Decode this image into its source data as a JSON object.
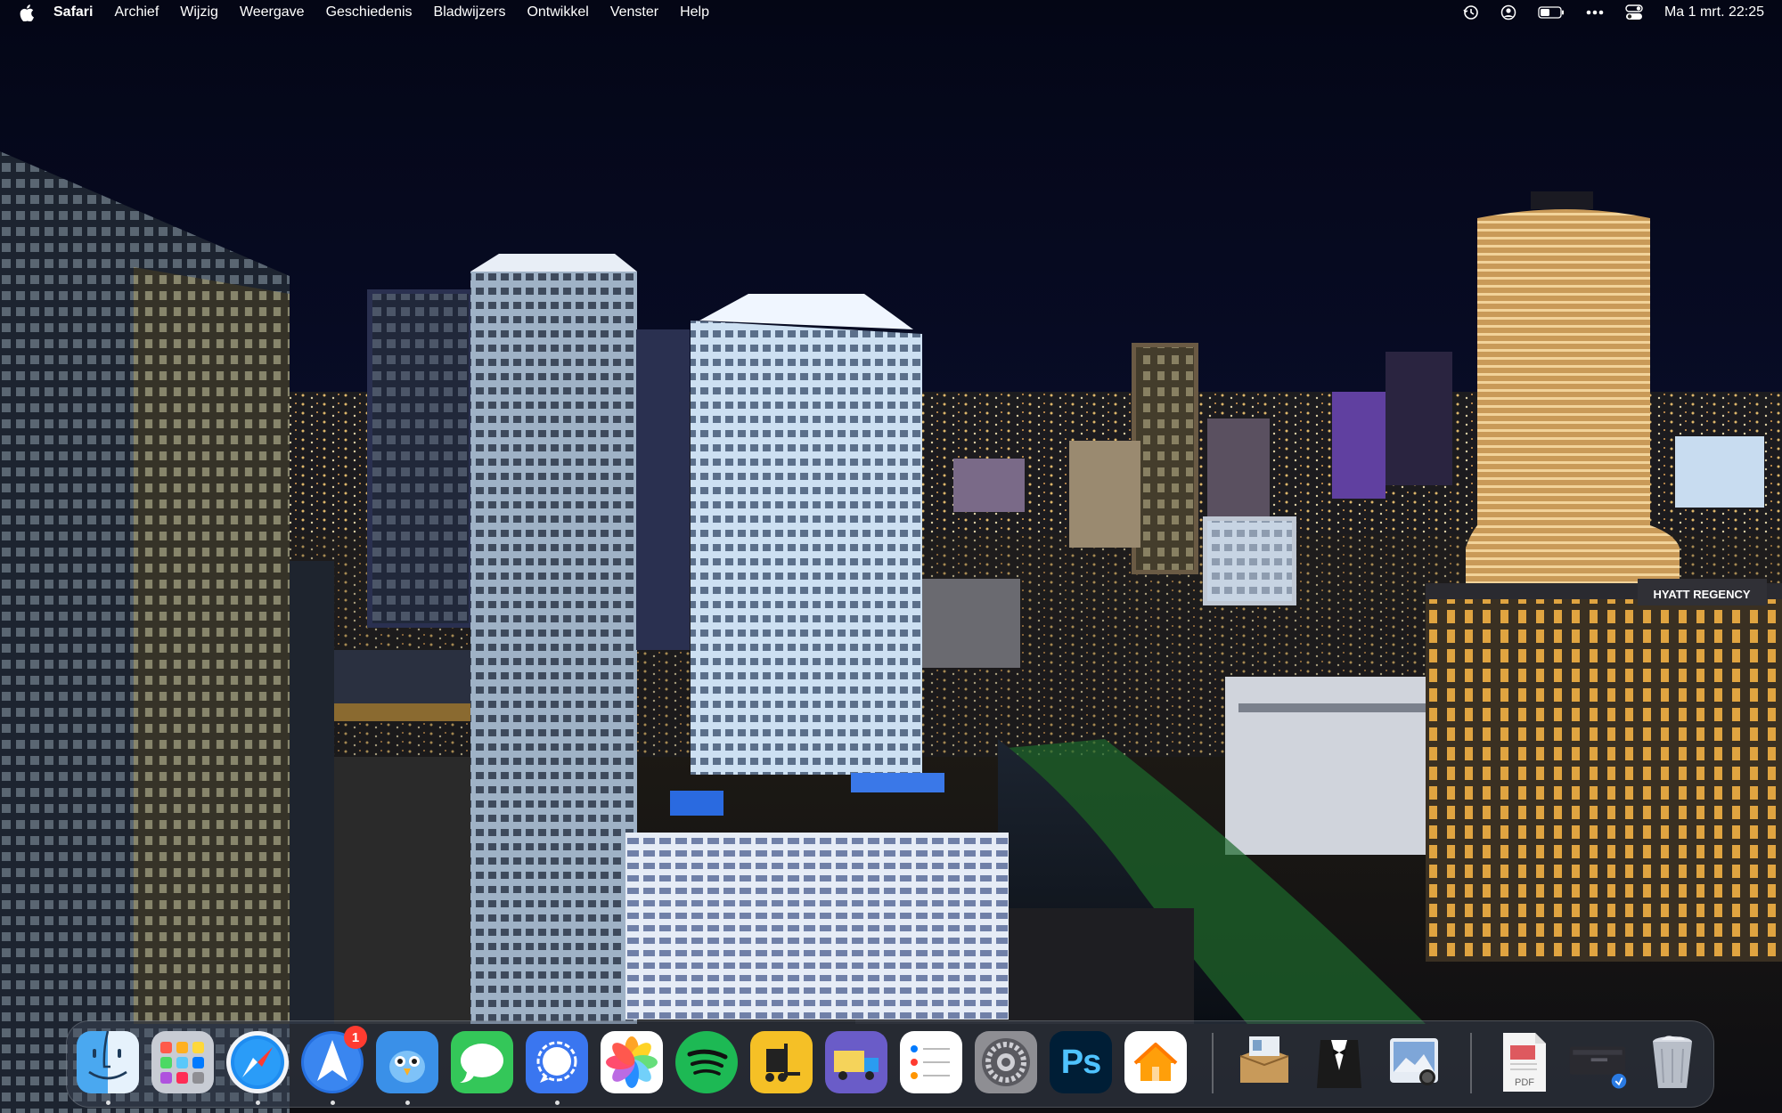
{
  "menubar": {
    "app_name": "Safari",
    "menus": [
      "Archief",
      "Wijzig",
      "Weergave",
      "Geschiedenis",
      "Bladwijzers",
      "Ontwikkel",
      "Venster",
      "Help"
    ],
    "status_icons": [
      "time-machine-icon",
      "user-icon",
      "battery-icon",
      "more-dots-icon",
      "control-center-icon"
    ],
    "clock": "Ma 1 mrt.  22:25"
  },
  "wallpaper": {
    "building_sign": "HYATT REGENCY"
  },
  "dock": {
    "apps": [
      {
        "name": "Finder",
        "icon": "finder-icon"
      },
      {
        "name": "Launchpad",
        "icon": "launchpad-icon"
      },
      {
        "name": "Safari",
        "icon": "safari-icon"
      },
      {
        "name": "Spark",
        "icon": "spark-mail-icon",
        "badge": "1"
      },
      {
        "name": "Tweetbot",
        "icon": "tweetbot-icon"
      },
      {
        "name": "Berichten",
        "icon": "messages-icon"
      },
      {
        "name": "Signal",
        "icon": "signal-icon"
      },
      {
        "name": "Foto's",
        "icon": "photos-icon"
      },
      {
        "name": "Spotify",
        "icon": "spotify-icon"
      },
      {
        "name": "Forklift",
        "icon": "forklift-icon"
      },
      {
        "name": "Transmit",
        "icon": "transmit-truck-icon"
      },
      {
        "name": "Herinneringen",
        "icon": "reminders-icon"
      },
      {
        "name": "Systeemvoorkeuren",
        "icon": "system-preferences-icon"
      },
      {
        "name": "Photoshop",
        "icon": "photoshop-icon",
        "label": "Ps"
      },
      {
        "name": "Woning",
        "icon": "home-icon"
      }
    ],
    "utilities": [
      {
        "name": "The Unarchiver",
        "icon": "unarchiver-box-icon"
      },
      {
        "name": "Bartender",
        "icon": "bartender-tuxedo-icon"
      },
      {
        "name": "Preview",
        "icon": "preview-icon"
      }
    ],
    "stack": [
      {
        "name": "Document",
        "icon": "pdf-document-icon",
        "label": "PDF"
      },
      {
        "name": "Downloads",
        "icon": "downloads-stack-icon"
      },
      {
        "name": "Prullenmand",
        "icon": "trash-icon"
      }
    ]
  },
  "colors": {
    "sky": "#050818",
    "menubar_text": "#ffffff",
    "badge": "#ff3b30",
    "spotify": "#1db954",
    "messages": "#34c759",
    "signal": "#3a76f0",
    "photoshop_bg": "#001e36",
    "photoshop_text": "#4fc3ff"
  }
}
